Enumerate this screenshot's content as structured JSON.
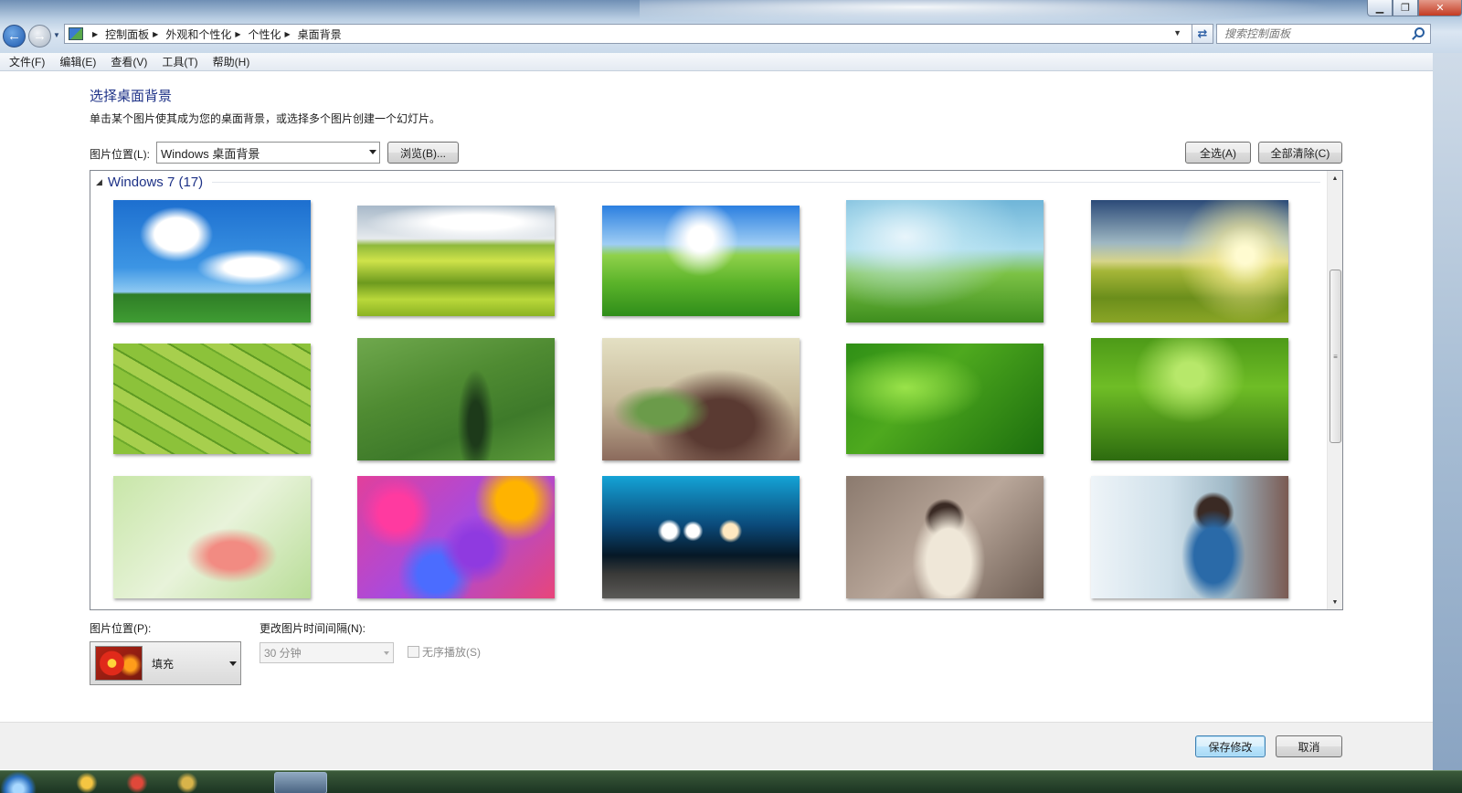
{
  "window": {
    "controls": {
      "minimize": "▁",
      "maximize": "❐",
      "close": "✕"
    }
  },
  "nav": {
    "back_icon": "arrow-left",
    "forward_icon": "arrow-right"
  },
  "address_bar": {
    "breadcrumbs": [
      "控制面板",
      "外观和个性化",
      "个性化",
      "桌面背景"
    ]
  },
  "search": {
    "placeholder": "搜索控制面板"
  },
  "menu": [
    "文件(F)",
    "编辑(E)",
    "查看(V)",
    "工具(T)",
    "帮助(H)"
  ],
  "page": {
    "title": "选择桌面背景",
    "description": "单击某个图片使其成为您的桌面背景，或选择多个图片创建一个幻灯片。"
  },
  "picture_location": {
    "label": "图片位置(L):",
    "value": "Windows 桌面背景",
    "browse_label": "浏览(B)..."
  },
  "select_all_label": "全选(A)",
  "clear_all_label": "全部清除(C)",
  "gallery": {
    "group_title": "Windows 7 (17)",
    "wallpapers": [
      {
        "name": "sky-clouds-grass"
      },
      {
        "name": "rolling-hills"
      },
      {
        "name": "green-hill-sun"
      },
      {
        "name": "grass-closeup"
      },
      {
        "name": "sunset-field"
      },
      {
        "name": "aerial-fields"
      },
      {
        "name": "river-meadow"
      },
      {
        "name": "fern-bokeh"
      },
      {
        "name": "grass-blades-droplets"
      },
      {
        "name": "lotus-leaves"
      },
      {
        "name": "pink-flower"
      },
      {
        "name": "colorful-flowers"
      },
      {
        "name": "bokeh-lights-wood"
      },
      {
        "name": "girl-winter"
      },
      {
        "name": "girl-street"
      }
    ]
  },
  "position": {
    "label": "图片位置(P):",
    "value": "填充"
  },
  "interval": {
    "label": "更改图片时间间隔(N):",
    "value": "30 分钟"
  },
  "shuffle_label": "无序播放(S)",
  "footer": {
    "save_label": "保存修改",
    "cancel_label": "取消"
  }
}
